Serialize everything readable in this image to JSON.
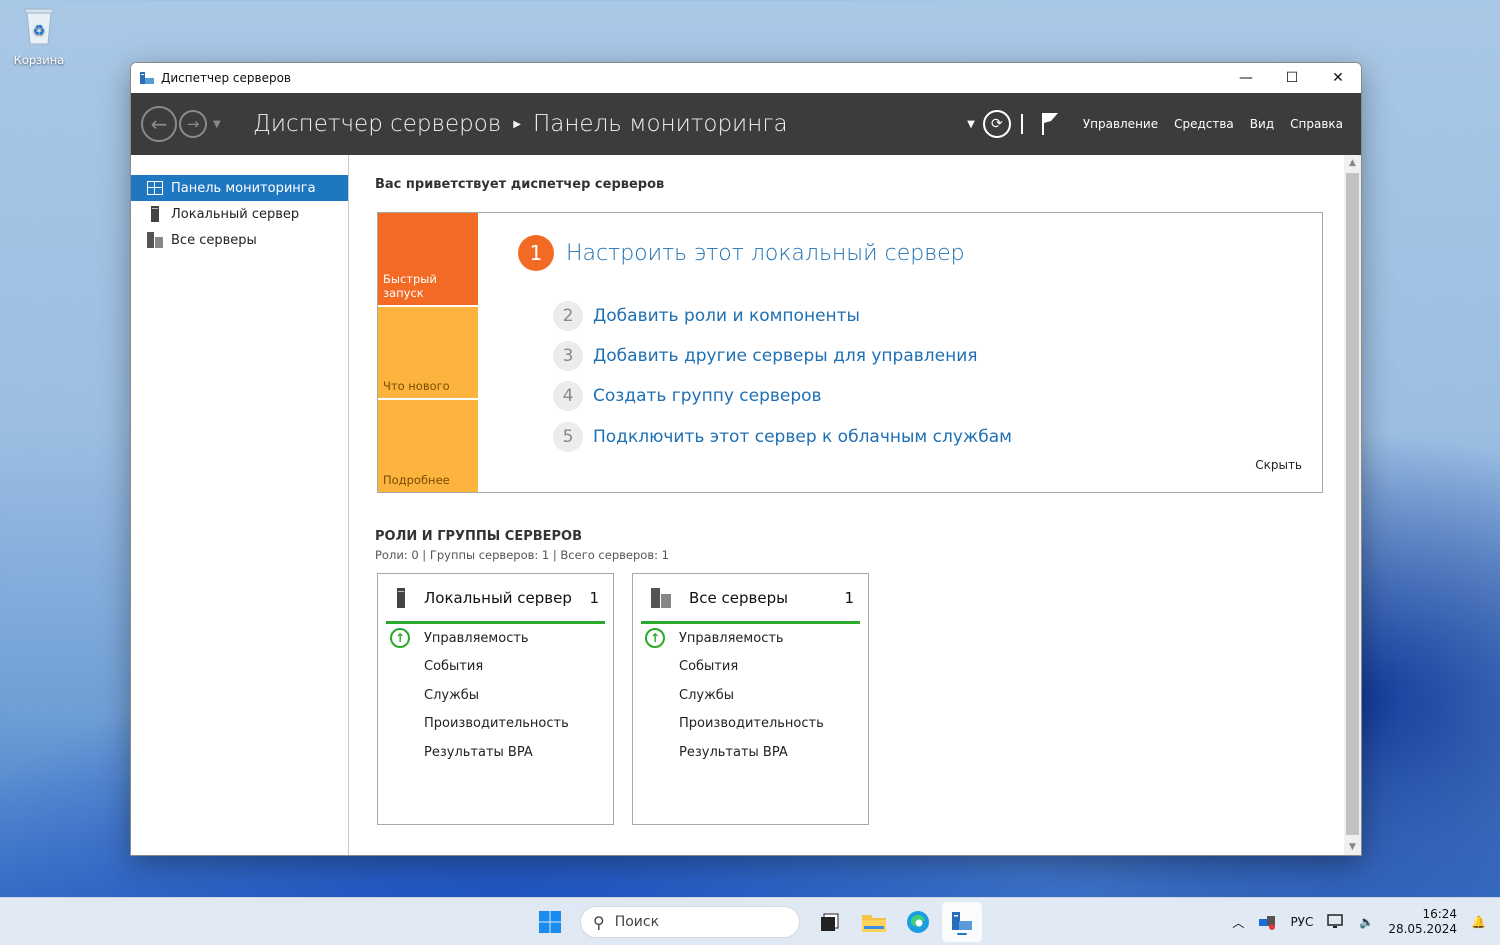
{
  "desktop": {
    "recycle_bin_label": "Корзина"
  },
  "window": {
    "title": "Диспетчер серверов",
    "controls": {
      "minimize": "—",
      "maximize": "☐",
      "close": "✕"
    }
  },
  "header": {
    "breadcrumb_root": "Диспетчер серверов",
    "breadcrumb_current": "Панель мониторинга",
    "menu": [
      "Управление",
      "Средства",
      "Вид",
      "Справка"
    ]
  },
  "sidebar": {
    "items": [
      {
        "label": "Панель мониторинга",
        "icon": "dashboard-icon",
        "active": true
      },
      {
        "label": "Локальный сервер",
        "icon": "server-icon",
        "active": false
      },
      {
        "label": "Все серверы",
        "icon": "servers-icon",
        "active": false
      }
    ]
  },
  "main": {
    "welcome": "Вас приветствует диспетчер серверов",
    "tiles": [
      "Быстрый запуск",
      "Что нового",
      "Подробнее"
    ],
    "steps": [
      {
        "num": "1",
        "label": "Настроить этот локальный сервер"
      },
      {
        "num": "2",
        "label": "Добавить роли и компоненты"
      },
      {
        "num": "3",
        "label": "Добавить другие серверы для управления"
      },
      {
        "num": "4",
        "label": "Создать группу серверов"
      },
      {
        "num": "5",
        "label": "Подключить этот сервер к облачным службам"
      }
    ],
    "hide_label": "Скрыть",
    "roles_title": "РОЛИ И ГРУППЫ СЕРВЕРОВ",
    "roles_subtitle": "Роли: 0 | Группы серверов: 1 | Всего серверов: 1",
    "cards": [
      {
        "title": "Локальный сервер",
        "count": "1",
        "rows": [
          "Управляемость",
          "События",
          "Службы",
          "Производительность",
          "Результаты BPA"
        ]
      },
      {
        "title": "Все серверы",
        "count": "1",
        "rows": [
          "Управляемость",
          "События",
          "Службы",
          "Производительность",
          "Результаты BPA"
        ]
      }
    ],
    "status_color": "#2ba92b",
    "accent_orange": "#f26a23",
    "accent_yellow": "#fdb43e"
  },
  "taskbar": {
    "search_placeholder": "Поиск",
    "language": "РУС",
    "time": "16:24",
    "date": "28.05.2024"
  }
}
